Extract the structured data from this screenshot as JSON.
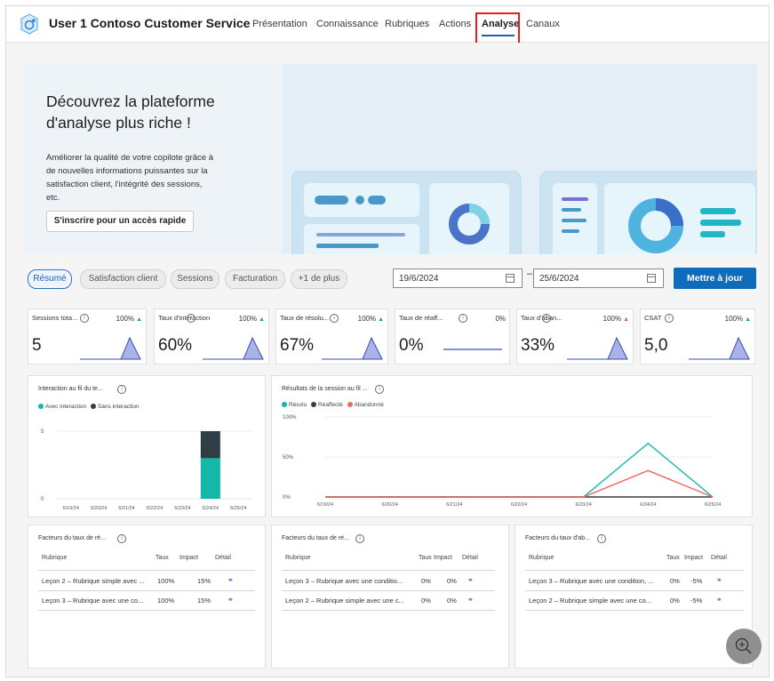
{
  "header": {
    "app_title": "User 1 Contoso Customer Service",
    "tabs": [
      {
        "label": "Présentation"
      },
      {
        "label": "Connaissance"
      },
      {
        "label": "Rubriques"
      },
      {
        "label": "Actions"
      },
      {
        "label": "Analyse"
      },
      {
        "label": "Canaux"
      }
    ],
    "active_tab": "Analyse"
  },
  "banner": {
    "title": "Découvrez la plateforme d'analyse plus riche !",
    "description": "Améliorer la qualité de votre copilote grâce à de nouvelles informations puissantes sur la satisfaction client, l'intégrité des sessions, etc.",
    "button_label": "S'inscrire pour un accès rapide"
  },
  "filters": {
    "pills": [
      "Résumé",
      "Satisfaction client",
      "Sessions",
      "Facturation",
      "+1 de plus"
    ],
    "selected": "Résumé",
    "start_date": "19/6/2024",
    "end_date": "25/6/2024",
    "separator": "–",
    "update_label": "Mettre à jour"
  },
  "metrics": [
    {
      "name": "Sessions tota...",
      "pct": "100%",
      "trend": "up",
      "value": "5"
    },
    {
      "name": "Taux d'interaction",
      "pct": "100%",
      "trend": "up",
      "value": "60%"
    },
    {
      "name": "Taux de résolu...",
      "pct": "100%",
      "trend": "up",
      "value": "67%"
    },
    {
      "name": "Taux de réaff...",
      "pct": "0%",
      "trend": "flat",
      "value": "0%"
    },
    {
      "name": "Taux d'aban...",
      "pct": "100%",
      "trend": "up-red",
      "value": "33%"
    },
    {
      "name": "CSAT",
      "pct": "100%",
      "trend": "up",
      "value": "5,0"
    }
  ],
  "chart_data": [
    {
      "type": "bar",
      "title": "Interaction au fil du te...",
      "categories": [
        "6/19/24",
        "6/20/24",
        "6/21/24",
        "6/22/24",
        "6/23/24",
        "6/24/24",
        "6/25/24"
      ],
      "series": [
        {
          "name": "Avec interaction",
          "values": [
            0,
            0,
            0,
            0,
            0,
            3,
            0
          ]
        },
        {
          "name": "Sans interaction",
          "values": [
            0,
            0,
            0,
            0,
            0,
            2,
            0
          ]
        }
      ],
      "yticks": [
        "5",
        "0"
      ],
      "stacked": true,
      "colors": [
        "#14b8a6",
        "#2f3e46"
      ]
    },
    {
      "type": "line",
      "title": "Résultats de la session au fil ...",
      "categories": [
        "6/19/24",
        "6/20/24",
        "6/21/24",
        "6/22/24",
        "6/23/24",
        "6/24/24",
        "6/25/24"
      ],
      "series": [
        {
          "name": "Résolu",
          "values": [
            0,
            0,
            0,
            0,
            0,
            67,
            0
          ]
        },
        {
          "name": "Réaffecté",
          "values": [
            0,
            0,
            0,
            0,
            0,
            0,
            0
          ]
        },
        {
          "name": "Abandonné",
          "values": [
            0,
            0,
            0,
            0,
            0,
            33,
            0
          ]
        }
      ],
      "yticks": [
        "100%",
        "50%",
        "0%"
      ],
      "ylim": [
        0,
        100
      ],
      "colors": [
        "#14b8a6",
        "#2f3e46",
        "#ef6a5e"
      ]
    }
  ],
  "tables": [
    {
      "title": "Facteurs du taux de ré...",
      "columns": [
        "Rubrique",
        "Taux",
        "Impact",
        "Détail"
      ],
      "rows": [
        {
          "topic": "Leçon 2 – Rubrique simple avec ...",
          "rate": "100%",
          "impact": "15%"
        },
        {
          "topic": "Leçon 3 – Rubrique avec une co...",
          "rate": "100%",
          "impact": "15%"
        }
      ]
    },
    {
      "title": "Facteurs du taux de ré...",
      "columns": [
        "Rubrique",
        "Taux",
        "Impact",
        "Détail"
      ],
      "rows": [
        {
          "topic": "Leçon 3 – Rubrique avec une conditio...",
          "rate": "0%",
          "impact": "0%"
        },
        {
          "topic": "Leçon 2 – Rubrique simple avec une c...",
          "rate": "0%",
          "impact": "0%"
        }
      ]
    },
    {
      "title": "Facteurs du taux d'ab...",
      "columns": [
        "Rubrique",
        "Taux",
        "Impact",
        "Détail"
      ],
      "rows": [
        {
          "topic": "Leçon 3 – Rubrique avec une condition, ...",
          "rate": "0%",
          "impact": "-5%"
        },
        {
          "topic": "Leçon 2 – Rubrique simple avec une co...",
          "rate": "0%",
          "impact": "-5%"
        }
      ]
    }
  ],
  "colors": {
    "accent": "#0f6cbd",
    "teal": "#14b8a6",
    "dark": "#2f3e46",
    "red": "#ef6a5e",
    "highlight": "#e02020"
  }
}
